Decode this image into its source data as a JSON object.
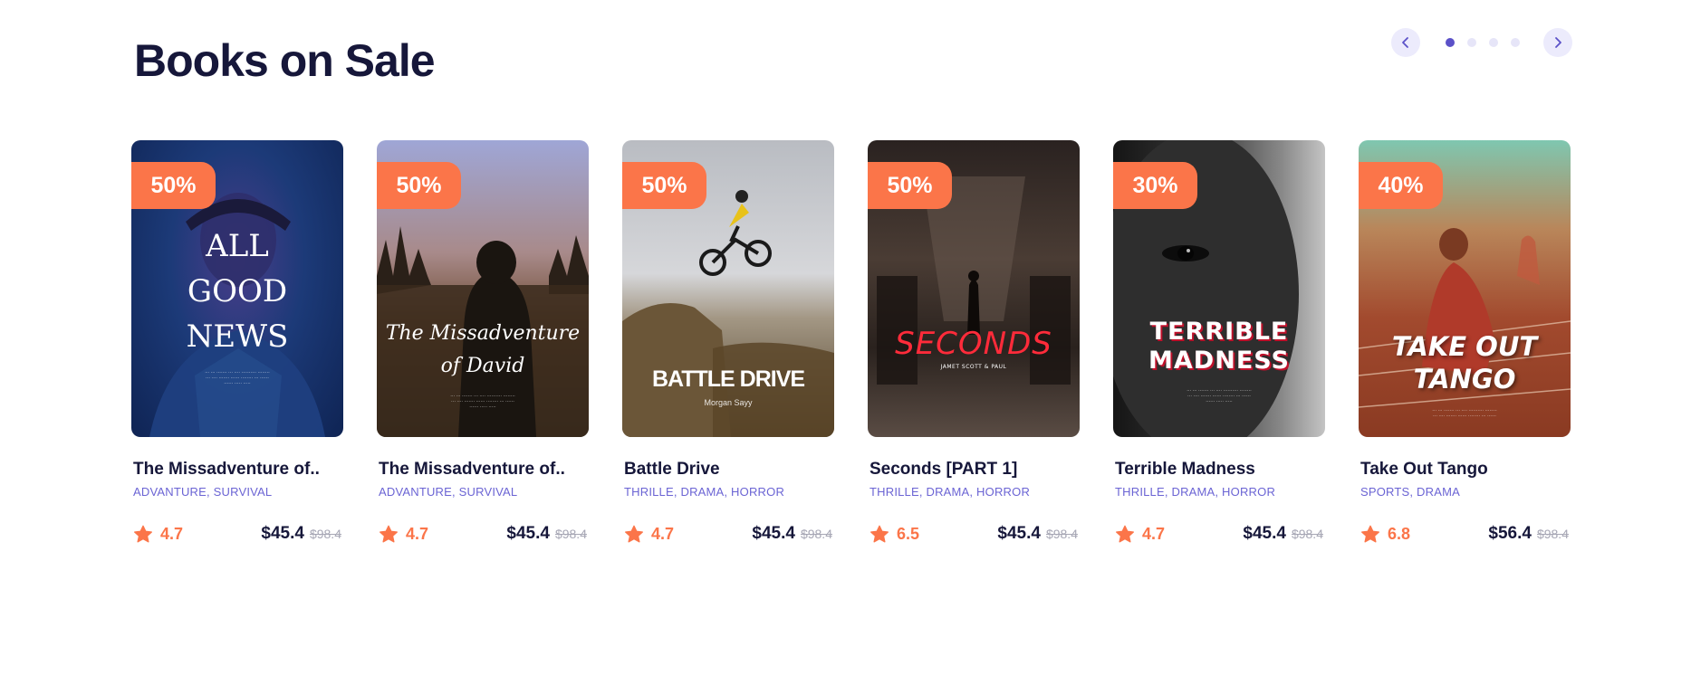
{
  "section": {
    "title": "Books on Sale"
  },
  "carousel": {
    "prev_icon": "chevron-left-icon",
    "next_icon": "chevron-right-icon",
    "dots": 4,
    "active_dot": 1
  },
  "colors": {
    "accent": "#fb7549",
    "brand": "#5b51c8",
    "genre": "#6b64d4",
    "heading": "#16173a"
  },
  "books": [
    {
      "discount": "50%",
      "cover_text": [
        "ALL",
        "GOOD",
        "NEWS"
      ],
      "name": "The Missadventure of..",
      "genres": "ADVANTURE, SURVIVAL",
      "rating": "4.7",
      "price": "$45.4",
      "old_price": "$98.4"
    },
    {
      "discount": "50%",
      "cover_text": [
        "The Missadventure",
        "of David"
      ],
      "name": "The Missadventure of..",
      "genres": "ADVANTURE, SURVIVAL",
      "rating": "4.7",
      "price": "$45.4",
      "old_price": "$98.4"
    },
    {
      "discount": "50%",
      "cover_text": [
        "BATTLE DRIVE",
        "Morgan Sayy"
      ],
      "name": "Battle Drive",
      "genres": "THRILLE, DRAMA, HORROR",
      "rating": "4.7",
      "price": "$45.4",
      "old_price": "$98.4"
    },
    {
      "discount": "50%",
      "cover_text": [
        "SECONDS",
        "JAMET SCOTT & PAUL"
      ],
      "name": "Seconds [PART 1]",
      "genres": "THRILLE, DRAMA, HORROR",
      "rating": "6.5",
      "price": "$45.4",
      "old_price": "$98.4"
    },
    {
      "discount": "30%",
      "cover_text": [
        "TERRIBLE",
        "MADNESS"
      ],
      "name": "Terrible Madness",
      "genres": "THRILLE, DRAMA, HORROR",
      "rating": "4.7",
      "price": "$45.4",
      "old_price": "$98.4"
    },
    {
      "discount": "40%",
      "cover_text": [
        "TAKE OUT",
        "TANGO"
      ],
      "name": "Take Out Tango",
      "genres": "SPORTS, DRAMA",
      "rating": "6.8",
      "price": "$56.4",
      "old_price": "$98.4"
    }
  ]
}
